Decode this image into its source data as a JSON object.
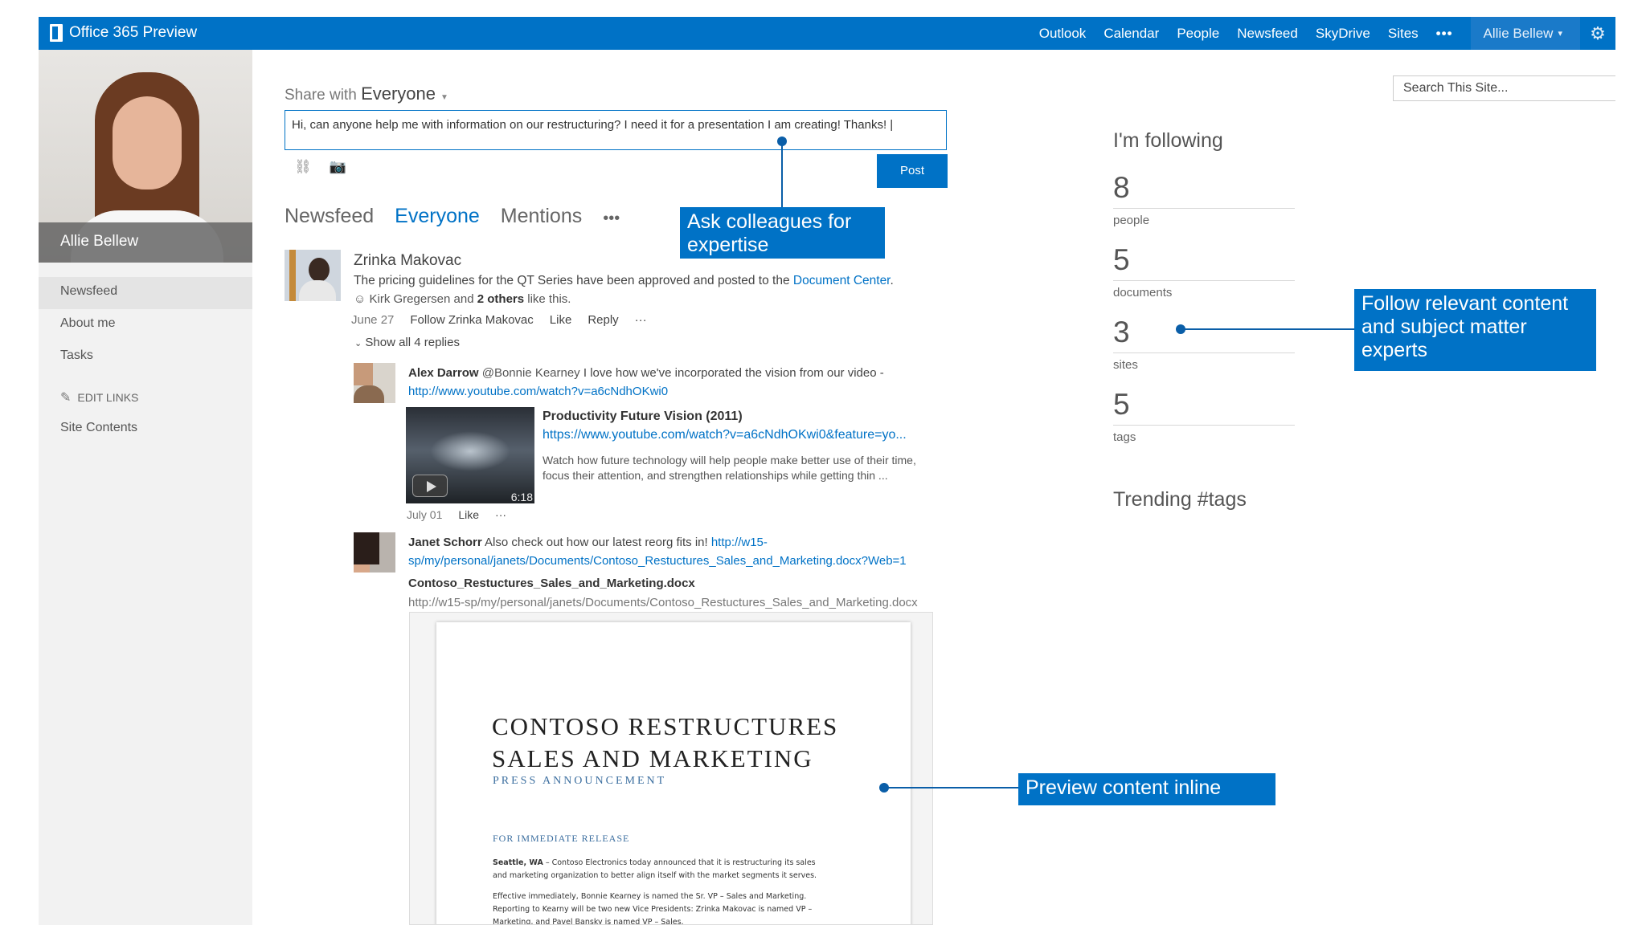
{
  "topbar": {
    "app_title": "Office 365 Preview",
    "nav": [
      "Outlook",
      "Calendar",
      "People",
      "Newsfeed",
      "SkyDrive",
      "Sites"
    ],
    "more": "•••",
    "user": "Allie Bellew",
    "user_caret": "▾",
    "gear": "⚙",
    "brand_color": "#0072c6"
  },
  "sidebar": {
    "profile_name": "Allie Bellew",
    "items": [
      "Newsfeed",
      "About me",
      "Tasks"
    ],
    "edit_links": "EDIT LINKS",
    "site_contents": "Site Contents"
  },
  "share": {
    "label": "Share with",
    "audience": "Everyone",
    "post_text": "Hi, can anyone help me with information on our restructuring?  I need it for a presentation I am creating!  Thanks! |",
    "post_button": "Post"
  },
  "tabs": [
    "Newsfeed",
    "Everyone",
    "Mentions"
  ],
  "tabs_more": "•••",
  "callouts": {
    "ask": "Ask colleagues for expertise",
    "follow": "Follow relevant content and subject matter experts",
    "preview": "Preview content inline"
  },
  "post1": {
    "author": "Zrinka Makovac",
    "text": "The pricing guidelines for the QT Series have been approved and posted to the ",
    "link": "Document Center",
    "text_end": ".",
    "likes_prefix": "Kirk Gregersen and ",
    "likes_bold": "2 others",
    "likes_suffix": " like this.",
    "date": "June 27",
    "follow": "Follow Zrinka Makovac",
    "like": "Like",
    "reply": "Reply",
    "more": "···",
    "show_replies": "Show all 4 replies"
  },
  "reply1": {
    "author": "Alex Darrow",
    "mention": " @Bonnie Kearney",
    "text": " I love how we've incorporated the vision from our video -",
    "link": "http://www.youtube.com/watch?v=a6cNdhOKwi0",
    "video_title": "Productivity Future Vision (2011)",
    "video_url": "https://www.youtube.com/watch?v=a6cNdhOKwi0&feature=yo...",
    "video_desc_1": "Watch how future technology will help people make better use of their time,",
    "video_desc_2": "focus their attention, and strengthen relationships while getting thin ...",
    "video_time": "6:18",
    "date": "July 01",
    "like": "Like",
    "more": "···"
  },
  "reply2": {
    "author": "Janet Schorr",
    "text": "  Also check out how our latest reorg fits in! ",
    "link_1": "http://w15-",
    "link_2": "sp/my/personal/janets/Documents/Contoso_Restuctures_Sales_and_Marketing.docx?Web=1",
    "doc_name": "Contoso_Restuctures_Sales_and_Marketing.docx",
    "doc_path": "http://w15-sp/my/personal/janets/Documents/Contoso_Restuctures_Sales_and_Marketing.docx"
  },
  "document": {
    "title_1": "CONTOSO RESTRUCTURES",
    "title_2": "SALES AND MARKETING",
    "subtitle": "PRESS ANNOUNCEMENT",
    "release": "FOR IMMEDIATE RELEASE",
    "para1_lead": "Seattle, WA",
    "para1_a": " – Contoso Electronics today announced that it is restructuring its sales",
    "para1_b": "and marketing organization to better align itself with the market segments it serves.",
    "para2_a": "Effective immediately, Bonnie Kearney is named the Sr. VP – Sales and Marketing.",
    "para2_b": "Reporting to Kearny will be two new Vice Presidents: Zrinka Makovac is named VP –",
    "para2_c": "Marketing, and Pavel Bansky is named VP – Sales."
  },
  "right": {
    "search_placeholder": "Search This Site...",
    "following_title": "I'm following",
    "stats": [
      {
        "value": "8",
        "label": "people"
      },
      {
        "value": "5",
        "label": "documents"
      },
      {
        "value": "3",
        "label": "sites"
      },
      {
        "value": "5",
        "label": "tags"
      }
    ],
    "trending": "Trending #tags"
  }
}
